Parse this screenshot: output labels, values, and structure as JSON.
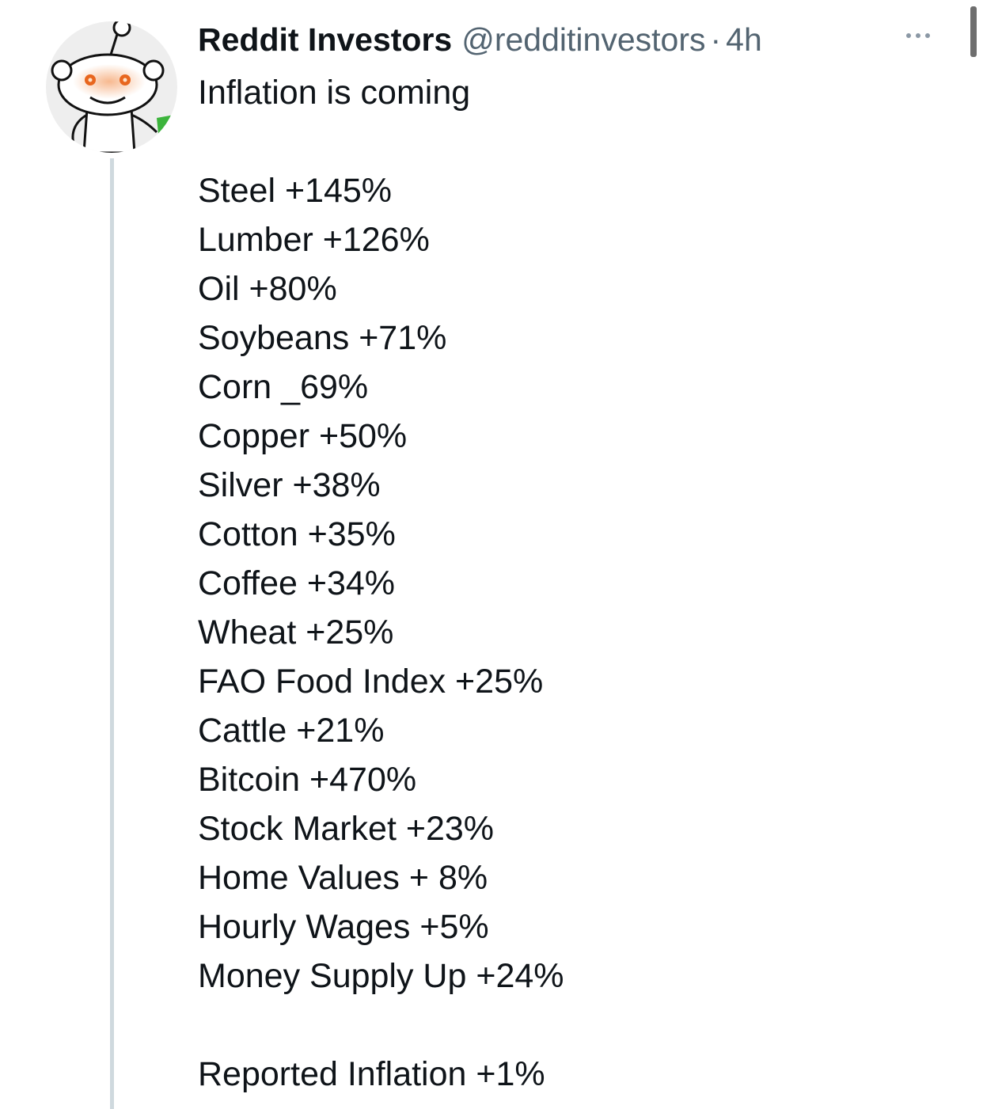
{
  "tweet": {
    "author_name": "Reddit Investors",
    "handle": "@redditinvestors",
    "separator": "·",
    "time": "4h",
    "intro": "Inflation is coming",
    "items": [
      "Steel +145%",
      "Lumber +126%",
      "Oil +80%",
      "Soybeans +71%",
      "Corn _69%",
      "Copper +50%",
      "Silver +38%",
      "Cotton +35%",
      "Coffee +34%",
      "Wheat +25%",
      "FAO Food Index +25%",
      "Cattle +21%",
      "Bitcoin +470%",
      "Stock Market +23%",
      "Home Values + 8%",
      "Hourly Wages +5%",
      "Money Supply Up +24%"
    ],
    "footer": "Reported Inflation +1%"
  },
  "icons": {
    "avatar": "reddit-snoo-avatar",
    "more": "more-options-icon"
  },
  "colors": {
    "text": "#0f1419",
    "secondary_text": "#536471",
    "thread_line": "#cfd9de",
    "avatar_bg": "#eeeeee",
    "eye": "#e8661e",
    "snoo_accent": "#3cb43c"
  }
}
